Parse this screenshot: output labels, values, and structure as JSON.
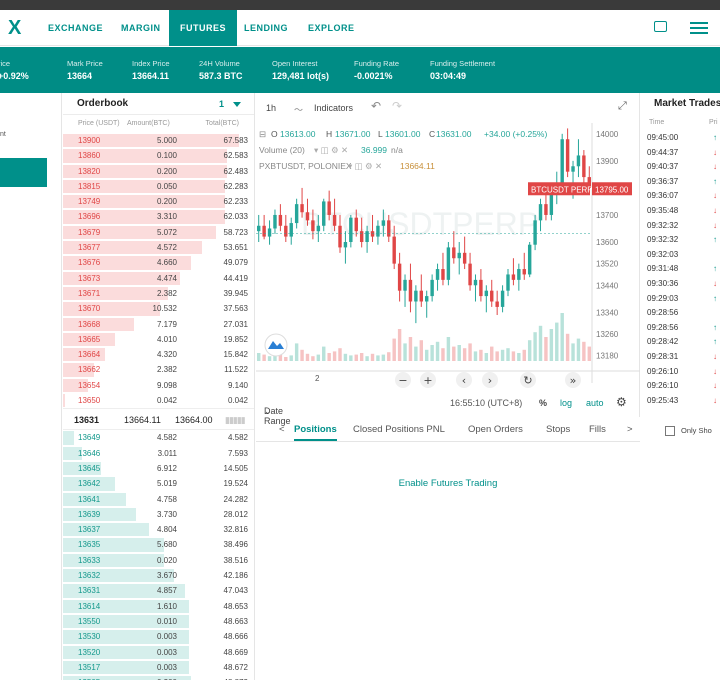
{
  "nav": {
    "logo": "X",
    "items": [
      "EXCHANGE",
      "MARGIN",
      "FUTURES",
      "LENDING",
      "EXPLORE"
    ],
    "active": "FUTURES"
  },
  "ticker": [
    {
      "label": "rice",
      "value": "+0.92%"
    },
    {
      "label": "Mark Price",
      "value": "13664"
    },
    {
      "label": "Index Price",
      "value": "13664.11"
    },
    {
      "label": "24H Volume",
      "value": "587.3 BTC"
    },
    {
      "label": "Open Interest",
      "value": "129,481 lot(s)"
    },
    {
      "label": "Funding Rate",
      "value": "-0.0021%"
    },
    {
      "label": "Funding Settlement",
      "value": "03:04:49"
    }
  ],
  "left_panel": {
    "fragment": "nt"
  },
  "orderbook": {
    "title": "Orderbook",
    "depth_select": "1",
    "columns": [
      "Price (USDT)",
      "Amount(BTC)",
      "Total(BTC)"
    ],
    "asks": [
      {
        "price": "13900",
        "amount": "5.000",
        "total": "67.583",
        "depth": 0.92
      },
      {
        "price": "13860",
        "amount": "0.100",
        "total": "62.583",
        "depth": 0.86
      },
      {
        "price": "13820",
        "amount": "0.200",
        "total": "62.483",
        "depth": 0.86
      },
      {
        "price": "13815",
        "amount": "0.050",
        "total": "62.283",
        "depth": 0.85
      },
      {
        "price": "13749",
        "amount": "0.200",
        "total": "62.233",
        "depth": 0.85
      },
      {
        "price": "13696",
        "amount": "3.310",
        "total": "62.033",
        "depth": 0.85
      },
      {
        "price": "13679",
        "amount": "5.072",
        "total": "58.723",
        "depth": 0.8
      },
      {
        "price": "13677",
        "amount": "4.572",
        "total": "53.651",
        "depth": 0.73
      },
      {
        "price": "13676",
        "amount": "4.660",
        "total": "49.079",
        "depth": 0.67
      },
      {
        "price": "13673",
        "amount": "4.474",
        "total": "44.419",
        "depth": 0.61
      },
      {
        "price": "13671",
        "amount": "2.382",
        "total": "39.945",
        "depth": 0.55
      },
      {
        "price": "13670",
        "amount": "10.532",
        "total": "37.563",
        "depth": 0.51
      },
      {
        "price": "13668",
        "amount": "7.179",
        "total": "27.031",
        "depth": 0.37
      },
      {
        "price": "13665",
        "amount": "4.010",
        "total": "19.852",
        "depth": 0.27
      },
      {
        "price": "13664",
        "amount": "4.320",
        "total": "15.842",
        "depth": 0.22
      },
      {
        "price": "13662",
        "amount": "2.382",
        "total": "11.522",
        "depth": 0.16
      },
      {
        "price": "13654",
        "amount": "9.098",
        "total": "9.140",
        "depth": 0.13
      },
      {
        "price": "13650",
        "amount": "0.042",
        "total": "0.042",
        "depth": 0.01
      }
    ],
    "mid": {
      "last": "13631",
      "index": "13664.11",
      "mark": "13664.00"
    },
    "bids": [
      {
        "price": "13649",
        "amount": "4.582",
        "total": "4.582",
        "depth": 0.06
      },
      {
        "price": "13646",
        "amount": "3.011",
        "total": "7.593",
        "depth": 0.1
      },
      {
        "price": "13645",
        "amount": "6.912",
        "total": "14.505",
        "depth": 0.2
      },
      {
        "price": "13642",
        "amount": "5.019",
        "total": "19.524",
        "depth": 0.27
      },
      {
        "price": "13641",
        "amount": "4.758",
        "total": "24.282",
        "depth": 0.33
      },
      {
        "price": "13639",
        "amount": "3.730",
        "total": "28.012",
        "depth": 0.38
      },
      {
        "price": "13637",
        "amount": "4.804",
        "total": "32.816",
        "depth": 0.45
      },
      {
        "price": "13635",
        "amount": "5.680",
        "total": "38.496",
        "depth": 0.53
      },
      {
        "price": "13633",
        "amount": "0.020",
        "total": "38.516",
        "depth": 0.53
      },
      {
        "price": "13632",
        "amount": "3.670",
        "total": "42.186",
        "depth": 0.58
      },
      {
        "price": "13631",
        "amount": "4.857",
        "total": "47.043",
        "depth": 0.64
      },
      {
        "price": "13614",
        "amount": "1.610",
        "total": "48.653",
        "depth": 0.66
      },
      {
        "price": "13550",
        "amount": "0.010",
        "total": "48.663",
        "depth": 0.66
      },
      {
        "price": "13530",
        "amount": "0.003",
        "total": "48.666",
        "depth": 0.66
      },
      {
        "price": "13520",
        "amount": "0.003",
        "total": "48.669",
        "depth": 0.66
      },
      {
        "price": "13517",
        "amount": "0.003",
        "total": "48.672",
        "depth": 0.66
      },
      {
        "price": "13505",
        "amount": "0.200",
        "total": "48.872",
        "depth": 0.67
      }
    ]
  },
  "chart": {
    "interval": "1h",
    "indicators_label": "Indicators",
    "ohlc": {
      "o": "O",
      "o_val": "13613.00",
      "h": "H",
      "h_val": "13671.00",
      "l": "L",
      "l_val": "13601.00",
      "c": "C",
      "c_val": "13631.00",
      "chg": "+34.00 (+0.25%)"
    },
    "volume_label": "Volume (20)",
    "volume_value": "36.999",
    "volume_na": "n/a",
    "index_label": "PXBTUSDT, POLONIEX",
    "index_value": "13664.11",
    "watermark": "BTCUSDTPERP",
    "symbol_tag": "BTCUSDT PERP",
    "price_tag": "13795.00",
    "x_tick": "2",
    "date_range": "Date Range",
    "clock": "16:55:10 (UTC+8)",
    "pct": "%",
    "log": "log",
    "auto": "auto"
  },
  "chart_data": {
    "type": "candlestick",
    "y_ticks": [
      14000,
      13900,
      13700,
      13600,
      13520,
      13440,
      13340,
      13260,
      13180
    ],
    "ylim": [
      13160,
      14040
    ],
    "candles": [
      [
        13640,
        13700,
        13600,
        13660
      ],
      [
        13660,
        13700,
        13610,
        13620
      ],
      [
        13620,
        13680,
        13590,
        13650
      ],
      [
        13650,
        13720,
        13630,
        13700
      ],
      [
        13700,
        13740,
        13640,
        13660
      ],
      [
        13660,
        13700,
        13600,
        13620
      ],
      [
        13620,
        13690,
        13590,
        13670
      ],
      [
        13670,
        13760,
        13650,
        13740
      ],
      [
        13740,
        13800,
        13690,
        13710
      ],
      [
        13710,
        13760,
        13660,
        13680
      ],
      [
        13680,
        13720,
        13610,
        13640
      ],
      [
        13640,
        13700,
        13600,
        13660
      ],
      [
        13660,
        13760,
        13640,
        13750
      ],
      [
        13750,
        13790,
        13680,
        13700
      ],
      [
        13700,
        13760,
        13640,
        13660
      ],
      [
        13660,
        13700,
        13560,
        13580
      ],
      [
        13580,
        13640,
        13520,
        13600
      ],
      [
        13600,
        13700,
        13580,
        13690
      ],
      [
        13690,
        13720,
        13620,
        13640
      ],
      [
        13640,
        13690,
        13580,
        13600
      ],
      [
        13600,
        13660,
        13560,
        13640
      ],
      [
        13640,
        13700,
        13600,
        13620
      ],
      [
        13620,
        13680,
        13590,
        13660
      ],
      [
        13660,
        13720,
        13620,
        13680
      ],
      [
        13680,
        13700,
        13600,
        13620
      ],
      [
        13620,
        13660,
        13500,
        13520
      ],
      [
        13520,
        13560,
        13380,
        13420
      ],
      [
        13420,
        13480,
        13360,
        13460
      ],
      [
        13460,
        13520,
        13340,
        13380
      ],
      [
        13380,
        13440,
        13300,
        13420
      ],
      [
        13420,
        13480,
        13360,
        13380
      ],
      [
        13380,
        13420,
        13320,
        13400
      ],
      [
        13400,
        13480,
        13380,
        13460
      ],
      [
        13460,
        13520,
        13420,
        13500
      ],
      [
        13500,
        13560,
        13440,
        13460
      ],
      [
        13460,
        13600,
        13440,
        13580
      ],
      [
        13580,
        13640,
        13520,
        13540
      ],
      [
        13540,
        13600,
        13480,
        13560
      ],
      [
        13560,
        13620,
        13500,
        13520
      ],
      [
        13520,
        13560,
        13420,
        13440
      ],
      [
        13440,
        13480,
        13380,
        13460
      ],
      [
        13460,
        13500,
        13380,
        13400
      ],
      [
        13400,
        13440,
        13340,
        13420
      ],
      [
        13420,
        13460,
        13360,
        13380
      ],
      [
        13380,
        13420,
        13330,
        13360
      ],
      [
        13360,
        13440,
        13340,
        13420
      ],
      [
        13420,
        13500,
        13400,
        13480
      ],
      [
        13480,
        13540,
        13440,
        13460
      ],
      [
        13460,
        13520,
        13420,
        13500
      ],
      [
        13500,
        13560,
        13460,
        13480
      ],
      [
        13480,
        13600,
        13470,
        13590
      ],
      [
        13590,
        13700,
        13570,
        13680
      ],
      [
        13680,
        13760,
        13640,
        13740
      ],
      [
        13740,
        13780,
        13680,
        13700
      ],
      [
        13700,
        13800,
        13680,
        13780
      ],
      [
        13780,
        13860,
        13740,
        13820
      ],
      [
        13820,
        14000,
        13790,
        13980
      ],
      [
        13980,
        14020,
        13840,
        13860
      ],
      [
        13860,
        13900,
        13760,
        13880
      ],
      [
        13880,
        13980,
        13840,
        13920
      ],
      [
        13920,
        13940,
        13820,
        13840
      ],
      [
        13840,
        13880,
        13780,
        13800
      ]
    ],
    "volumes": [
      10,
      8,
      6,
      12,
      9,
      5,
      7,
      22,
      14,
      9,
      6,
      8,
      18,
      10,
      12,
      16,
      9,
      7,
      8,
      10,
      6,
      9,
      7,
      8,
      11,
      28,
      40,
      22,
      30,
      18,
      26,
      14,
      20,
      24,
      16,
      30,
      18,
      20,
      16,
      22,
      12,
      14,
      10,
      18,
      12,
      14,
      16,
      12,
      10,
      14,
      26,
      36,
      44,
      30,
      40,
      48,
      60,
      34,
      22,
      28,
      24,
      18
    ],
    "volume_colors": [
      "up",
      "dn",
      "up",
      "up",
      "dn",
      "dn",
      "up",
      "up",
      "dn",
      "dn",
      "dn",
      "up",
      "up",
      "dn",
      "dn",
      "dn",
      "up",
      "up",
      "dn",
      "dn",
      "up",
      "dn",
      "up",
      "up",
      "dn",
      "dn",
      "dn",
      "up",
      "dn",
      "up",
      "dn",
      "up",
      "up",
      "up",
      "dn",
      "up",
      "dn",
      "up",
      "dn",
      "dn",
      "up",
      "dn",
      "up",
      "dn",
      "dn",
      "up",
      "up",
      "dn",
      "up",
      "dn",
      "up",
      "up",
      "up",
      "dn",
      "up",
      "up",
      "up",
      "dn",
      "up",
      "up",
      "dn",
      "dn"
    ]
  },
  "tabs": {
    "prev": "<",
    "items": [
      "Positions",
      "Closed Positions PNL",
      "Open Orders",
      "Stops",
      "Fills"
    ],
    "active": "Positions",
    "next": ">"
  },
  "empty_message": "Enable Futures Trading",
  "market_trades": {
    "title": "Market Trades",
    "columns": [
      "Time",
      "Pri"
    ],
    "rows": [
      {
        "time": "09:45:00",
        "dir": "up"
      },
      {
        "time": "09:44:37",
        "dir": "dn"
      },
      {
        "time": "09:40:37",
        "dir": "dn"
      },
      {
        "time": "09:36:37",
        "dir": "up"
      },
      {
        "time": "09:36:07",
        "dir": "dn"
      },
      {
        "time": "09:35:48",
        "dir": "dn"
      },
      {
        "time": "09:32:32",
        "dir": "dn"
      },
      {
        "time": "09:32:32",
        "dir": "up"
      },
      {
        "time": "09:32:03",
        "dir": ""
      },
      {
        "time": "09:31:48",
        "dir": "up"
      },
      {
        "time": "09:30:36",
        "dir": "dn"
      },
      {
        "time": "09:29:03",
        "dir": "up"
      },
      {
        "time": "09:28:56",
        "dir": ""
      },
      {
        "time": "09:28:56",
        "dir": "up"
      },
      {
        "time": "09:28:42",
        "dir": "up"
      },
      {
        "time": "09:28:31",
        "dir": "dn"
      },
      {
        "time": "09:26:10",
        "dir": "dn"
      },
      {
        "time": "09:26:10",
        "dir": "dn"
      },
      {
        "time": "09:25:43",
        "dir": "dn"
      }
    ],
    "only_show": "Only Sho"
  }
}
